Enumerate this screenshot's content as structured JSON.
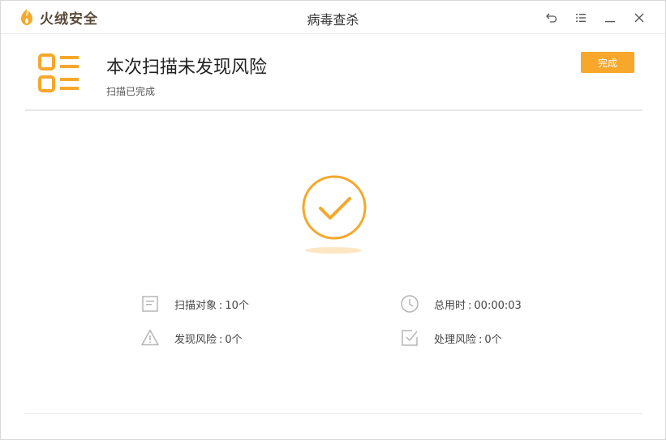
{
  "app": {
    "brand_name": "火绒安全",
    "window_title": "病毒查杀",
    "brand_color": "#f7a72a"
  },
  "window_controls": {
    "icons": [
      "back-icon",
      "menu-icon",
      "minimize-icon",
      "close-icon"
    ]
  },
  "result": {
    "title": "本次扫描未发现风险",
    "subtitle": "扫描已完成",
    "done_label": "完成"
  },
  "stats": {
    "scan_objects": {
      "label": "扫描对象",
      "value": "10个"
    },
    "total_time": {
      "label": "总用时",
      "value": "00:00:03"
    },
    "risks_found": {
      "label": "发现风险",
      "value": "0个"
    },
    "risks_handled": {
      "label": "处理风险",
      "value": "0个"
    }
  }
}
